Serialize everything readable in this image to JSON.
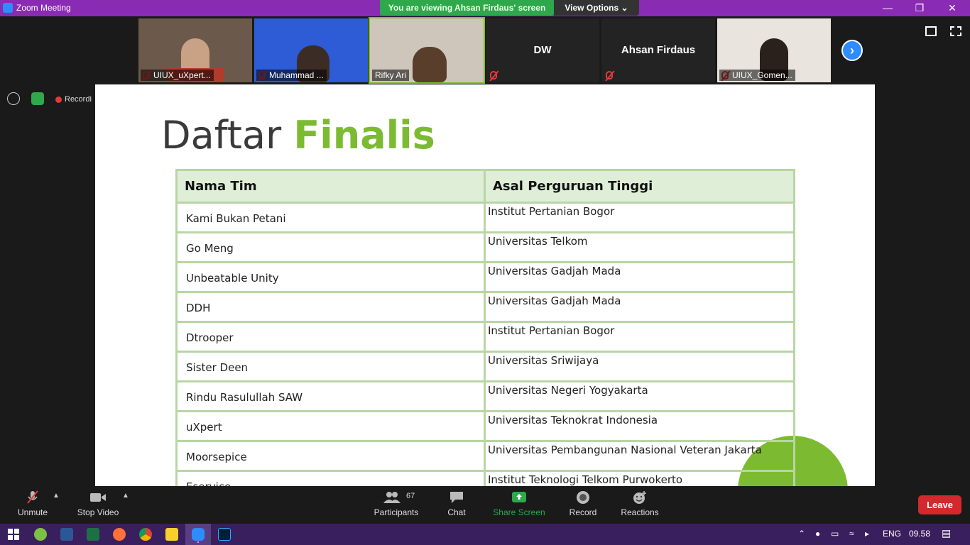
{
  "window": {
    "title": "Zoom Meeting",
    "share_banner": "You are viewing Ahsan Firdaus' screen",
    "view_options_label": "View Options"
  },
  "participants_strip": [
    {
      "name": "UIUX_uXpert...",
      "has_video": true,
      "muted": true
    },
    {
      "name": "Muhammad ...",
      "has_video": true,
      "muted": true
    },
    {
      "name": "Rifky Ari",
      "has_video": true,
      "muted": false,
      "active_speaker": true
    },
    {
      "name": "DW",
      "has_video": false,
      "muted": true
    },
    {
      "name": "Ahsan Firdaus",
      "has_video": false,
      "muted": true
    },
    {
      "name": "UIUX_Gomen...",
      "has_video": true,
      "muted": true
    }
  ],
  "recording_label": "Recordi",
  "slide": {
    "title_plain": "Daftar",
    "title_accent": "Finalis",
    "accent_color": "#7cbb31",
    "table": {
      "headers": [
        "Nama Tim",
        "Asal Perguruan Tinggi"
      ],
      "rows": [
        [
          "Kami Bukan Petani",
          "Institut Pertanian Bogor"
        ],
        [
          "Go Meng",
          "Universitas Telkom"
        ],
        [
          "Unbeatable Unity",
          "Universitas Gadjah Mada"
        ],
        [
          "DDH",
          "Universitas Gadjah Mada"
        ],
        [
          "Dtrooper",
          "Institut Pertanian Bogor"
        ],
        [
          "Sister Deen",
          "Universitas Sriwijaya"
        ],
        [
          "Rindu Rasulullah SAW",
          "Universitas Negeri Yogyakarta"
        ],
        [
          "uXpert",
          "Universitas Teknokrat Indonesia"
        ],
        [
          "Moorsepice",
          "Universitas Pembangunan Nasional Veteran Jakarta"
        ],
        [
          "Eservice",
          "Institut Teknologi Telkom Purwokerto"
        ]
      ]
    }
  },
  "controls": {
    "unmute": "Unmute",
    "stop_video": "Stop Video",
    "participants": "Participants",
    "participants_count": "67",
    "chat": "Chat",
    "share_screen": "Share Screen",
    "record": "Record",
    "reactions": "Reactions",
    "leave": "Leave"
  },
  "taskbar": {
    "language": "ENG",
    "time": "09.58"
  },
  "colors": {
    "title_bar": "#8a2bb4",
    "share_banner": "#2ea84b",
    "leave_button": "#d1292e",
    "share_screen_icon": "#2ea84b"
  }
}
